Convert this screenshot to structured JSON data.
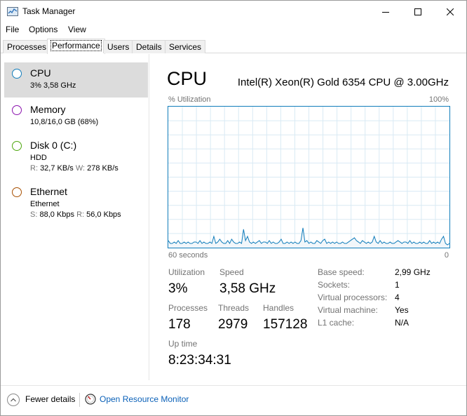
{
  "window": {
    "title": "Task Manager"
  },
  "menu": {
    "file": "File",
    "options": "Options",
    "view": "View"
  },
  "tabs": [
    {
      "label": "Processes"
    },
    {
      "label": "Performance"
    },
    {
      "label": "Users"
    },
    {
      "label": "Details"
    },
    {
      "label": "Services"
    }
  ],
  "sidebar": {
    "items": [
      {
        "name": "CPU",
        "line1": "3% 3,58 GHz",
        "color": "#117dbb"
      },
      {
        "name": "Memory",
        "line1": "10,8/16,0 GB (68%)",
        "color": "#8b12ae"
      },
      {
        "name": "Disk 0 (C:)",
        "line1": "HDD",
        "line2_r_label": "R:",
        "line2_r_value": "32,7 KB/s",
        "line2_w_label": "W:",
        "line2_w_value": "278 KB/s",
        "color": "#4da60c"
      },
      {
        "name": "Ethernet",
        "line1": "Ethernet",
        "line2_s_label": "S:",
        "line2_s_value": "88,0 Kbps",
        "line2_r_label": "R:",
        "line2_r_value": "56,0 Kbps",
        "color": "#a74f01"
      }
    ]
  },
  "main": {
    "title": "CPU",
    "model": "Intel(R) Xeon(R) Gold 6354 CPU @ 3.00GHz",
    "graph": {
      "y_label": "% Utilization",
      "y_max_label": "100%",
      "x_left_label": "60 seconds",
      "x_right_label": "0",
      "line_color": "#117dbb",
      "fill_color": "#f1f6fa",
      "grid_color": "#d9eaf4",
      "series_percent": [
        5,
        3,
        3,
        4,
        3,
        5,
        3,
        3,
        4,
        3,
        4,
        3,
        3,
        4,
        4,
        3,
        5,
        3,
        4,
        3,
        3,
        4,
        3,
        8,
        3,
        4,
        6,
        4,
        3,
        3,
        5,
        3,
        6,
        4,
        3,
        3,
        4,
        3,
        13,
        5,
        8,
        4,
        3,
        4,
        3,
        4,
        5,
        3,
        4,
        4,
        3,
        5,
        3,
        4,
        3,
        3,
        4,
        6,
        3,
        3,
        4,
        3,
        4,
        3,
        4,
        3,
        3,
        5,
        14,
        4,
        5,
        3,
        4,
        3,
        3,
        5,
        4,
        3,
        5,
        6,
        3,
        4,
        3,
        4,
        3,
        4,
        3,
        3,
        4,
        3,
        3,
        4,
        5,
        6,
        7,
        5,
        4,
        3,
        5,
        4,
        3,
        4,
        3,
        4,
        8,
        4,
        3,
        5,
        3,
        4,
        3,
        3,
        4,
        3,
        3,
        4,
        5,
        4,
        3,
        4,
        4,
        3,
        5,
        3,
        4,
        3,
        3,
        4,
        3,
        4,
        3,
        3,
        5,
        3,
        4,
        3,
        4,
        3,
        6,
        8,
        3,
        2,
        3
      ]
    },
    "stats": {
      "utilization_label": "Utilization",
      "utilization_value": "3%",
      "speed_label": "Speed",
      "speed_value": "3,58 GHz",
      "processes_label": "Processes",
      "processes_value": "178",
      "threads_label": "Threads",
      "threads_value": "2979",
      "handles_label": "Handles",
      "handles_value": "157128",
      "uptime_label": "Up time",
      "uptime_value": "8:23:34:31"
    },
    "specs": [
      {
        "label": "Base speed:",
        "value": "2,99 GHz"
      },
      {
        "label": "Sockets:",
        "value": "1"
      },
      {
        "label": "Virtual processors:",
        "value": "4"
      },
      {
        "label": "Virtual machine:",
        "value": "Yes"
      },
      {
        "label": "L1 cache:",
        "value": "N/A"
      }
    ]
  },
  "footer": {
    "fewer_details": "Fewer details",
    "open_resource_monitor": "Open Resource Monitor"
  }
}
